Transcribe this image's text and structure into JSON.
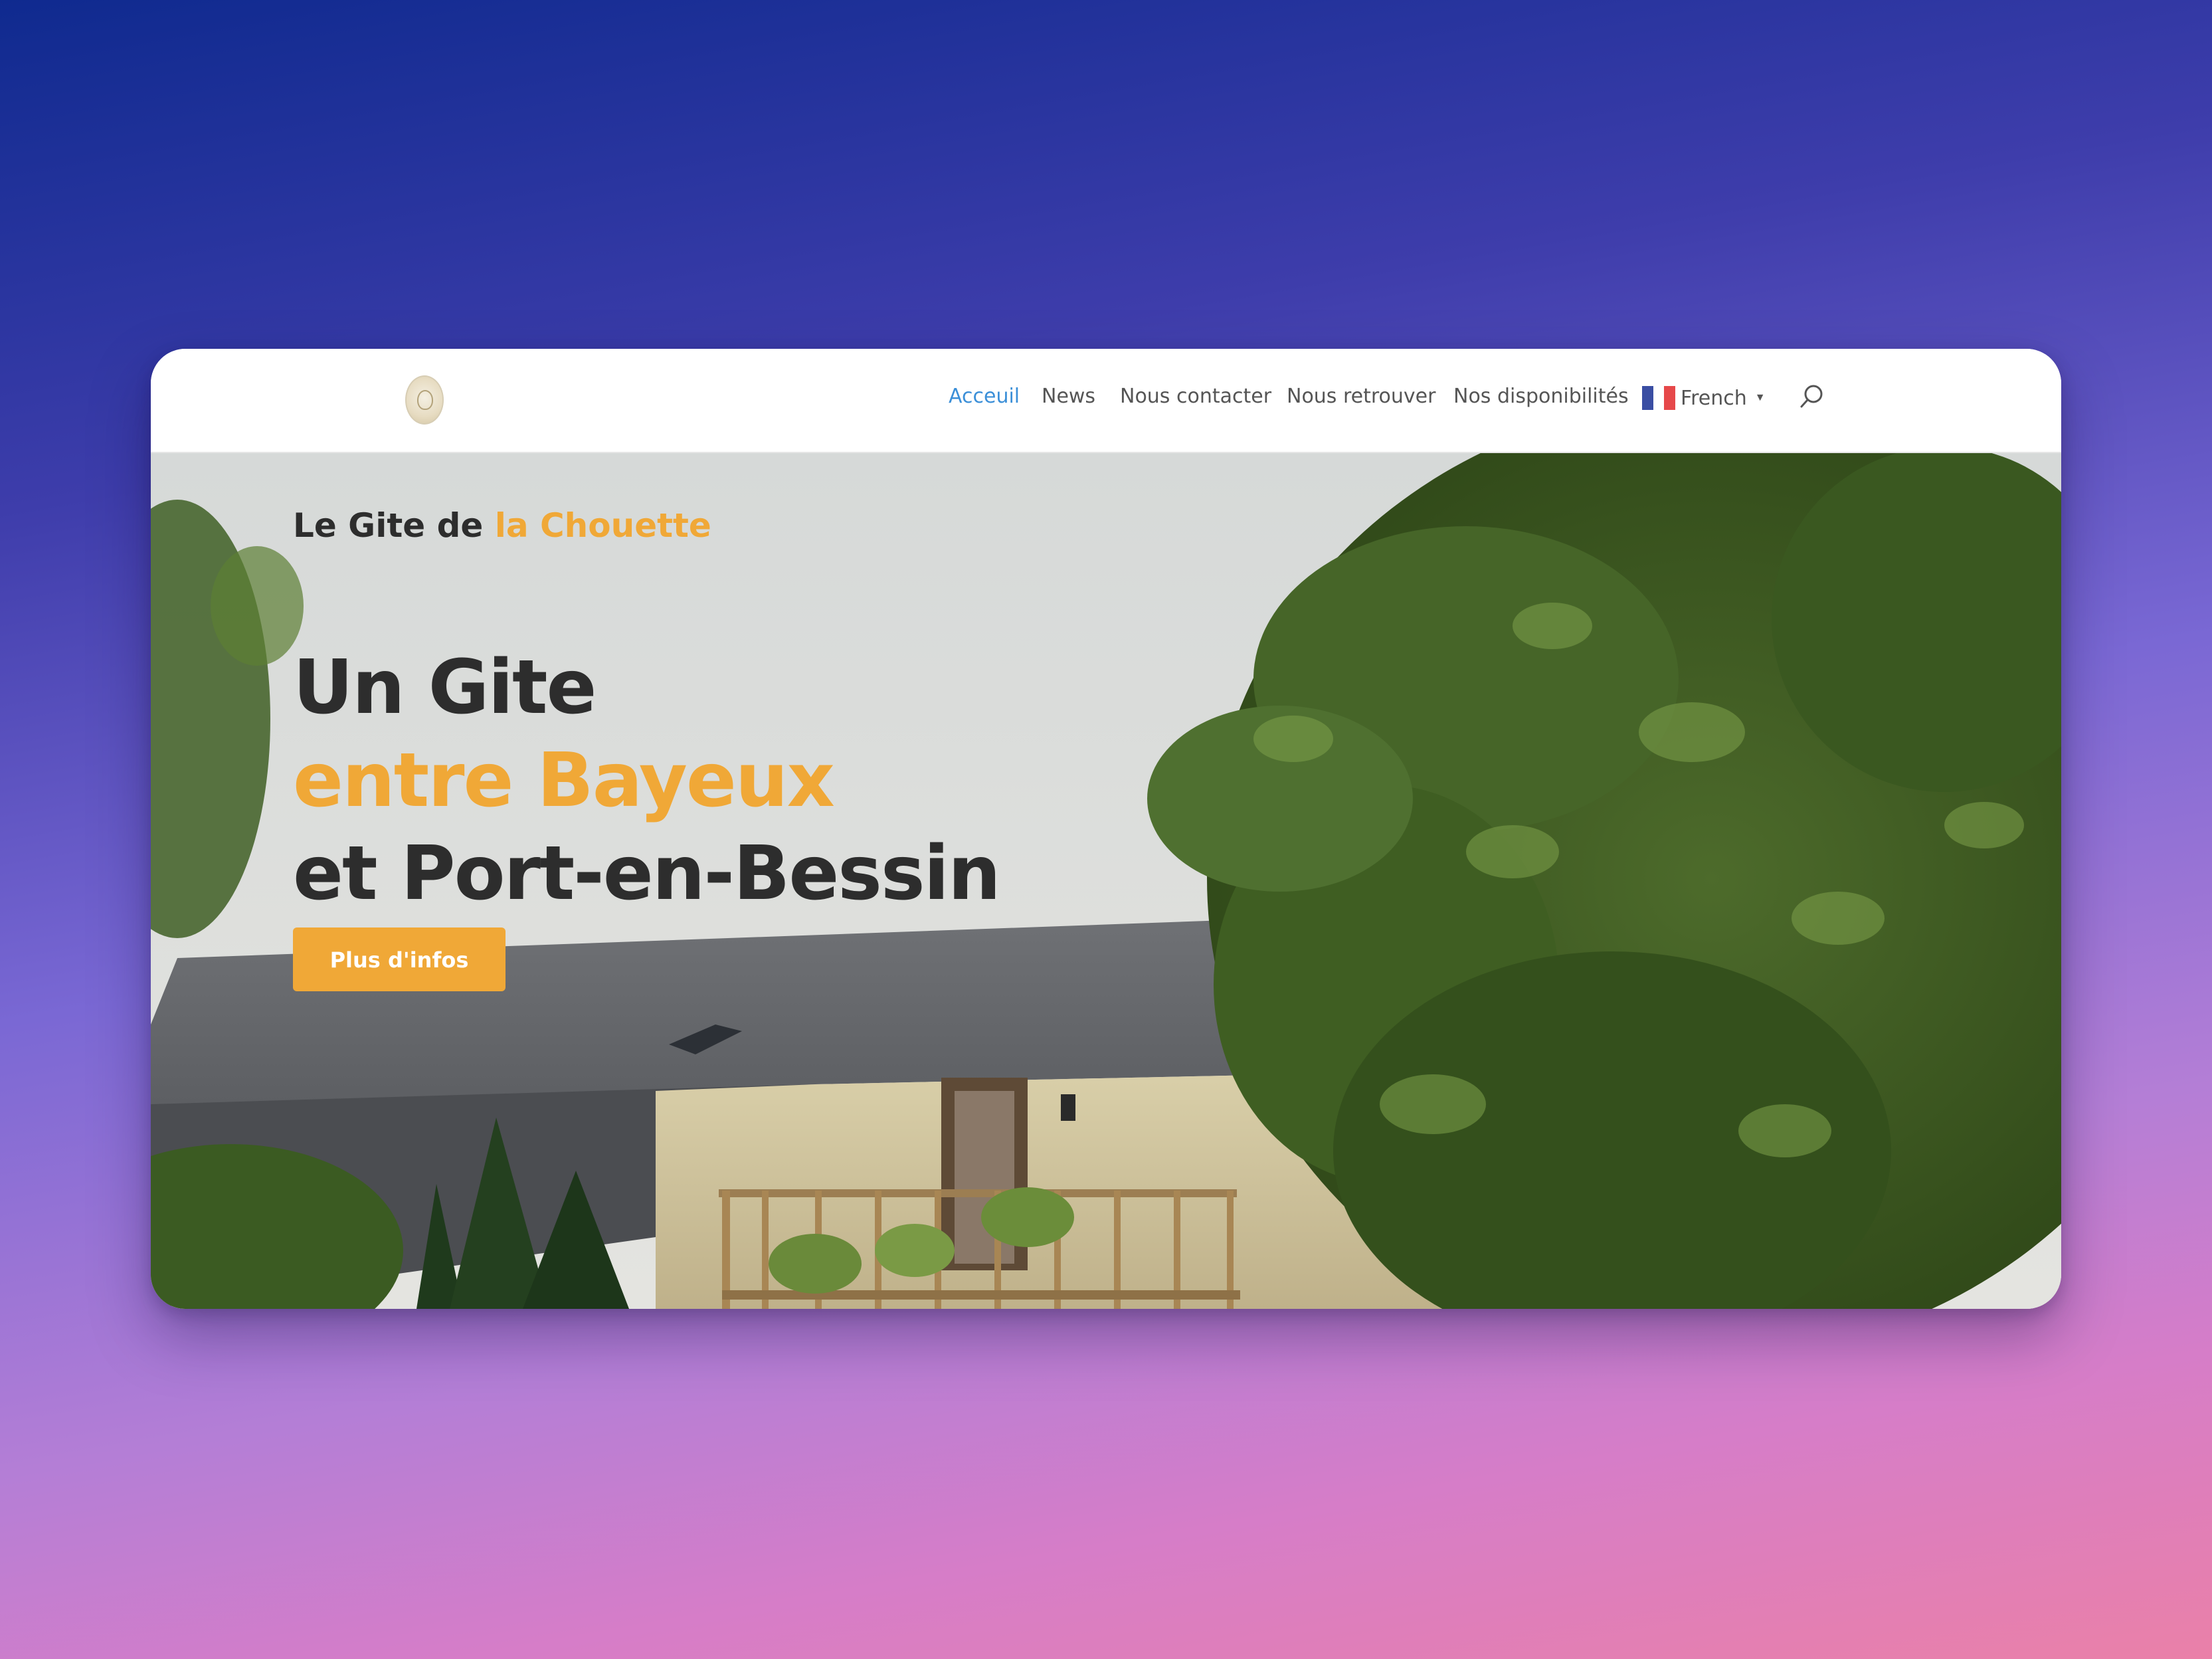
{
  "nav": {
    "items": [
      {
        "label": "Acceuil",
        "active": true
      },
      {
        "label": "News",
        "active": false
      },
      {
        "label": "Nous contacter",
        "active": false
      },
      {
        "label": "Nous retrouver",
        "active": false
      },
      {
        "label": "Nos disponibilités",
        "active": false
      }
    ],
    "language": {
      "label": "French",
      "flag_icon": "france-flag-icon"
    },
    "search_icon": "search-icon"
  },
  "hero": {
    "kicker_prefix": "Le Gite de ",
    "kicker_accent": "la Chouette",
    "title_line1": "Un Gite",
    "title_line2": "entre Bayeux",
    "title_line3": "et Port-en-Bessin",
    "cta_label": "Plus d'infos"
  },
  "colors": {
    "accent": "#f0a837",
    "nav_active": "#3b8fd8",
    "text_dark": "#2d2d2d",
    "nav_text": "#555555"
  }
}
